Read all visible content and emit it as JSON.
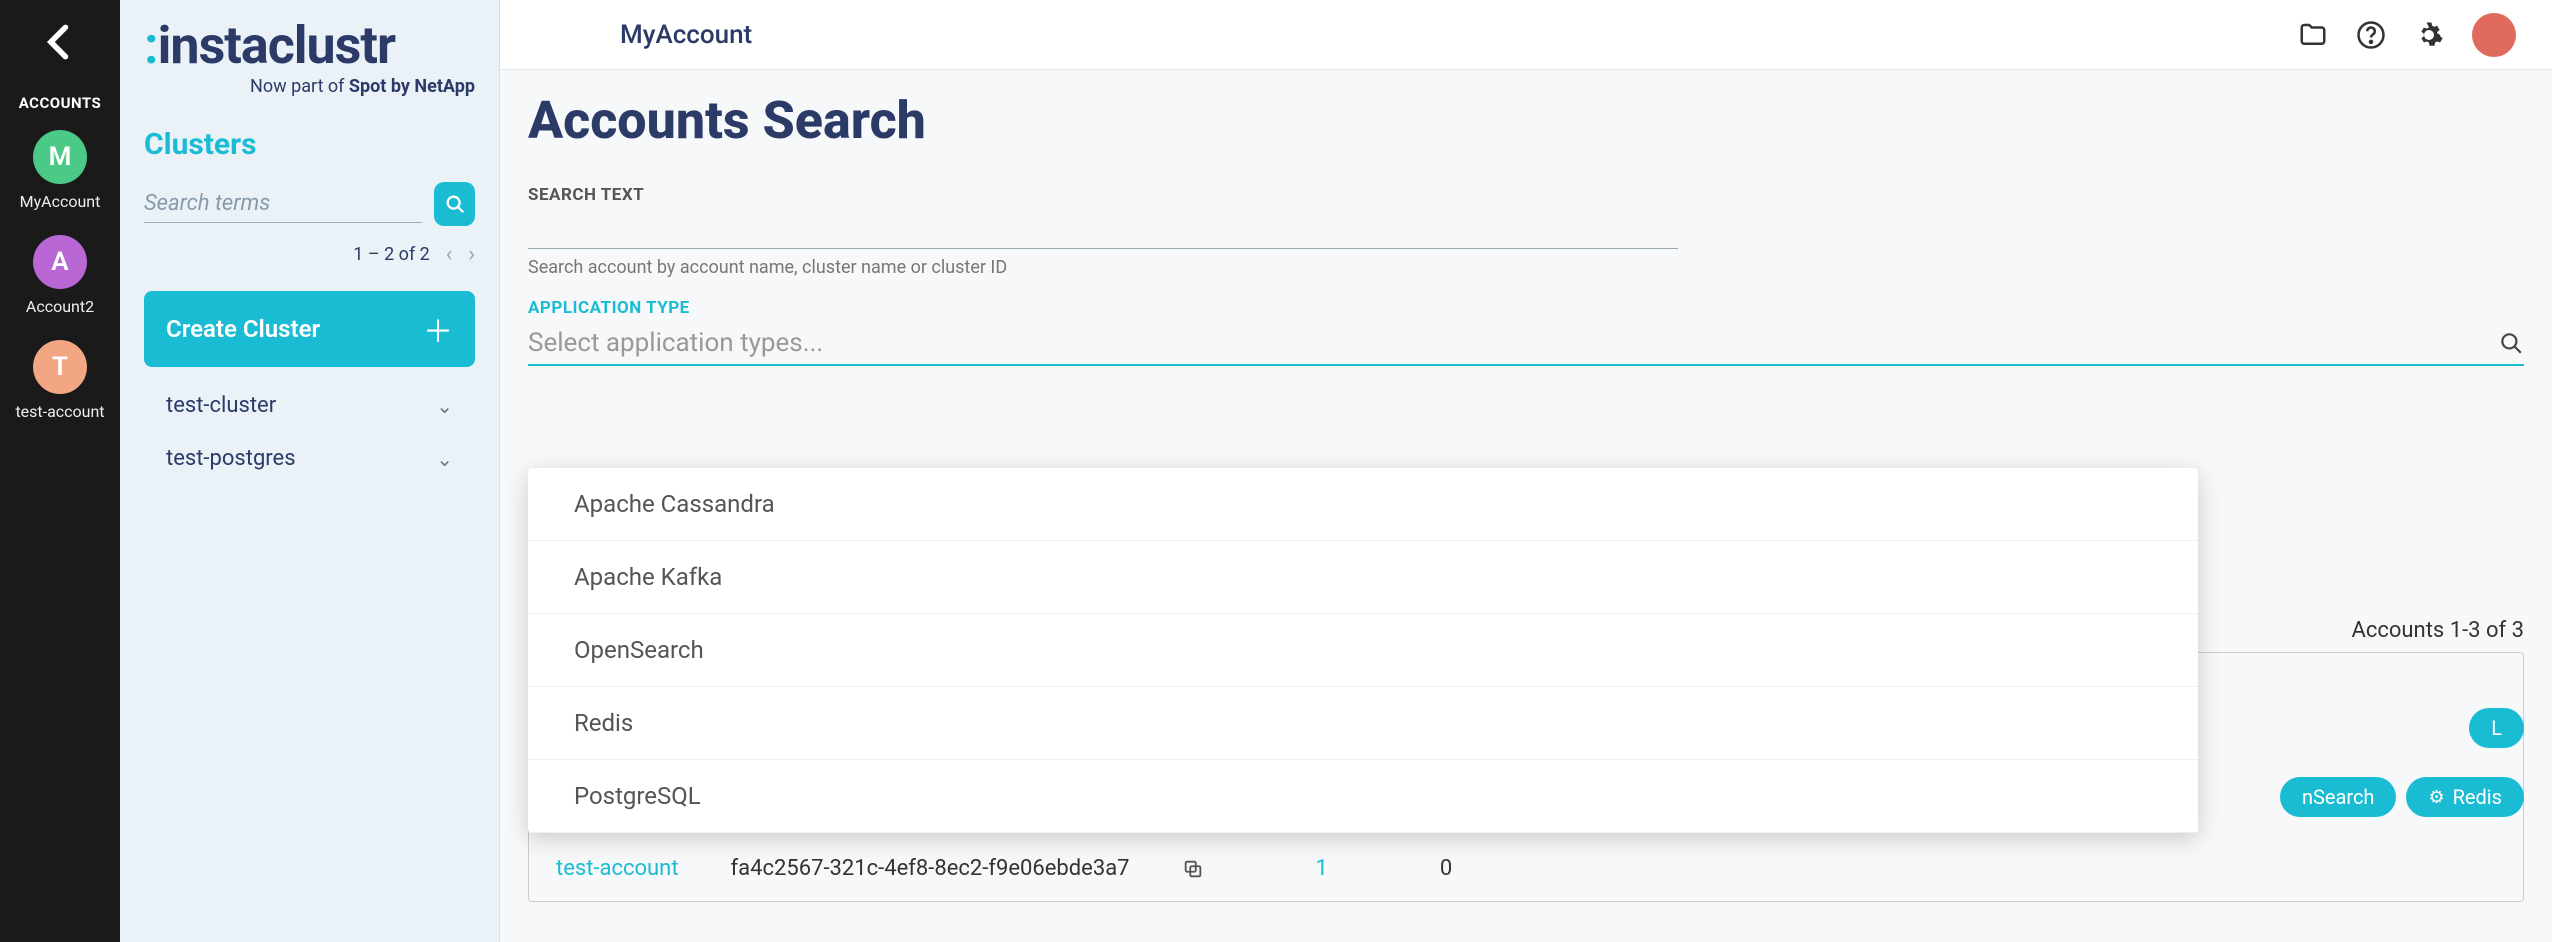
{
  "rail": {
    "label": "ACCOUNTS",
    "accounts": [
      {
        "initial": "M",
        "name": "MyAccount",
        "color": "green"
      },
      {
        "initial": "A",
        "name": "Account2",
        "color": "purple"
      },
      {
        "initial": "T",
        "name": "test-account",
        "color": "orange"
      }
    ]
  },
  "sidebar": {
    "brand_main": "instaclustr",
    "brand_sub_prefix": "Now part of ",
    "brand_sub_bold": "Spot by NetApp",
    "heading": "Clusters",
    "search_placeholder": "Search terms",
    "pager_text": "1 – 2 of 2",
    "create_label": "Create Cluster",
    "clusters": [
      {
        "name": "test-cluster"
      },
      {
        "name": "test-postgres"
      }
    ]
  },
  "topbar": {
    "title": "MyAccount"
  },
  "page": {
    "title": "Accounts Search",
    "search_label": "SEARCH TEXT",
    "search_helper": "Search account by account name, cluster name or cluster ID",
    "apptype_label": "APPLICATION TYPE",
    "apptype_placeholder": "Select application types...",
    "dropdown_options": [
      "Apache Cassandra",
      "Apache Kafka",
      "OpenSearch",
      "Redis",
      "PostgreSQL"
    ],
    "results_meta": "Accounts 1-3 of 3",
    "partial_pill_1": "L",
    "partial_pill_2a": "nSearch",
    "partial_pill_2b": "Redis",
    "visible_row": {
      "account_name": "test-account",
      "account_id": "fa4c2567-321c-4ef8-8ec2-f9e06ebde3a7",
      "clusters": "1",
      "running": "0"
    }
  }
}
